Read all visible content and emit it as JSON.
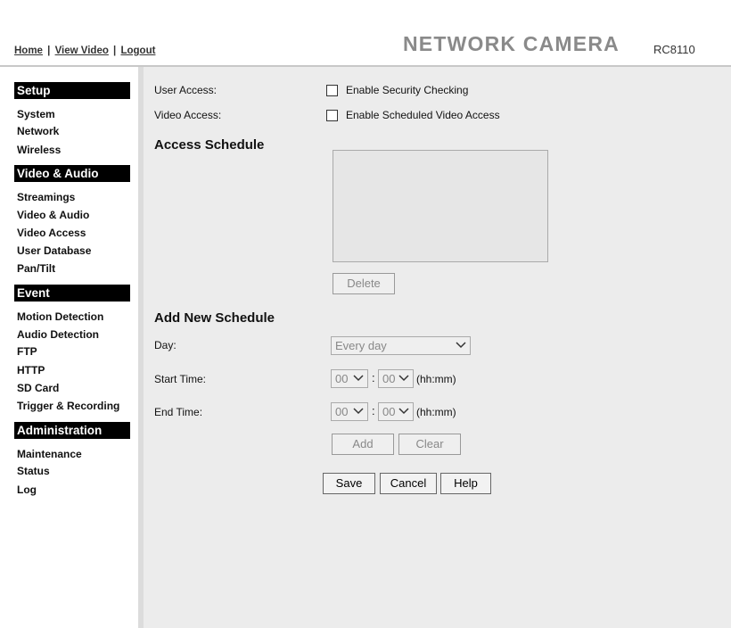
{
  "header": {
    "nav": [
      "Home",
      "View Video",
      "Logout"
    ],
    "brand": "NETWORK CAMERA",
    "model": "RC8110"
  },
  "sidebar": {
    "sections": [
      {
        "title": "Setup",
        "items": [
          "System",
          "Network",
          "Wireless"
        ]
      },
      {
        "title": "Video & Audio",
        "items": [
          "Streamings",
          "Video & Audio",
          "Video Access",
          "User Database",
          "Pan/Tilt"
        ]
      },
      {
        "title": "Event",
        "items": [
          "Motion Detection",
          "Audio Detection",
          "FTP",
          "HTTP",
          "SD Card",
          "Trigger & Recording"
        ]
      },
      {
        "title": "Administration",
        "items": [
          "Maintenance",
          "Status",
          "Log"
        ]
      }
    ],
    "active_item": "Video Access"
  },
  "main": {
    "user_access_label": "User Access:",
    "user_access_checkbox": "Enable Security Checking",
    "video_access_label": "Video Access:",
    "video_access_checkbox": "Enable Scheduled Video Access",
    "access_schedule_title": "Access Schedule",
    "delete_button": "Delete",
    "add_new_schedule_title": "Add New Schedule",
    "day_label": "Day:",
    "day_value": "Every day",
    "start_time_label": "Start Time:",
    "start_hour": "00",
    "start_minute": "00",
    "end_time_label": "End Time:",
    "end_hour": "00",
    "end_minute": "00",
    "time_colon": ":",
    "time_hint": "(hh:mm)",
    "add_button": "Add",
    "clear_button": "Clear",
    "save_button": "Save",
    "cancel_button": "Cancel",
    "help_button": "Help"
  },
  "colors": {
    "main_bg": "#ececec",
    "section_header_bg": "#000000",
    "brand_text": "#8a8a8a"
  }
}
